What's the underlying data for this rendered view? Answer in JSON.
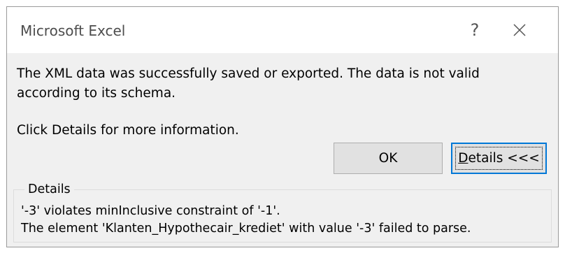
{
  "window": {
    "title": "Microsoft Excel",
    "help_label": "?"
  },
  "message": {
    "line1": "The XML data was successfully saved or exported. The data is not valid",
    "line2": "according to its schema.",
    "hint": "Click Details for more information."
  },
  "buttons": {
    "ok_label": "OK",
    "details_mnemonic": "D",
    "details_rest": "etails <<<"
  },
  "details": {
    "legend": "Details",
    "line1": "'-3' violates minInclusive constraint of '-1'.",
    "line2": "The element 'Klanten_Hypothecair_krediet' with value '-3' failed to parse."
  }
}
